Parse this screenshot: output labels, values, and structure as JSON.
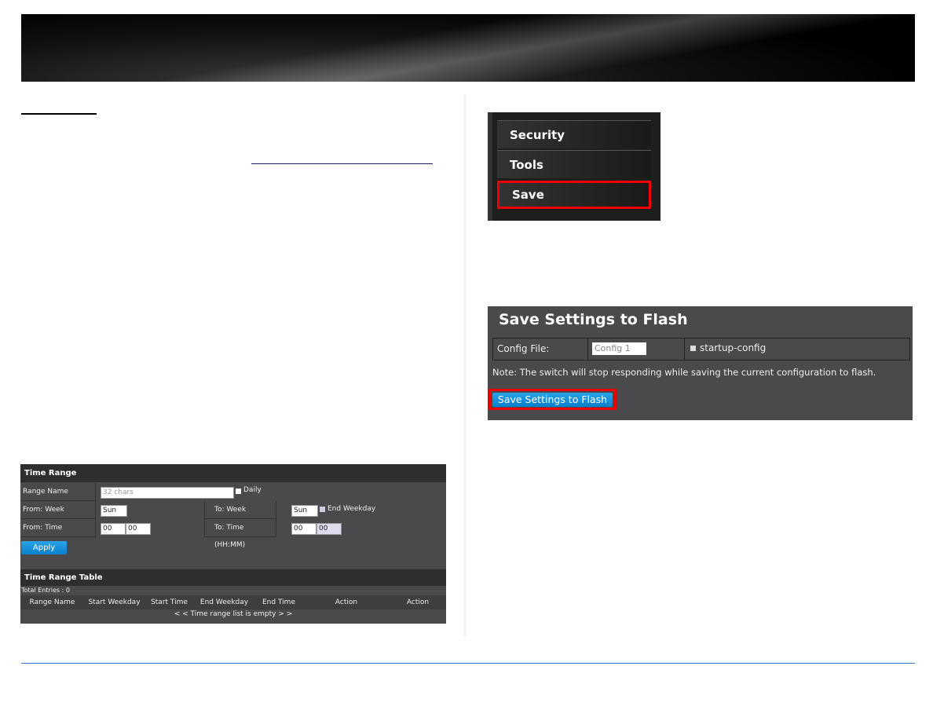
{
  "menu": {
    "items": [
      "Security",
      "Tools",
      "Save"
    ]
  },
  "time_range": {
    "title": "Time Range",
    "range_name_label": "Range Name",
    "range_name_placeholder": "32 chars",
    "daily_label": "Daily",
    "from_week_label": "From: Week",
    "from_week_value": "Sun",
    "to_week_label": "To: Week",
    "to_week_value": "Sun",
    "end_weekday_label": "End Weekday",
    "from_time_label": "From: Time (HH:MM)",
    "from_hh": "00",
    "from_mm": "00",
    "to_time_label": "To: Time (HH:MM)",
    "to_hh": "00",
    "to_mm": "00",
    "apply_label": "Apply",
    "table_title": "Time Range Table",
    "total_entries": "Total Entries : 0",
    "columns": [
      "Range Name",
      "Start Weekday",
      "Start Time",
      "End Weekday",
      "End Time",
      "Action",
      "Action"
    ],
    "empty_message": "< < Time range list is empty > >"
  },
  "save_flash": {
    "title": "Save Settings to Flash",
    "config_file_label": "Config File:",
    "config_file_value": "Config 1",
    "startup_config_label": "startup-config",
    "note": "Note: The switch will stop responding while saving the current configuration to flash.",
    "button_label": "Save Settings to Flash"
  },
  "colors": {
    "accent": "#0a7fcc",
    "highlight": "#e00000",
    "footer_line": "#3a7fd5"
  }
}
